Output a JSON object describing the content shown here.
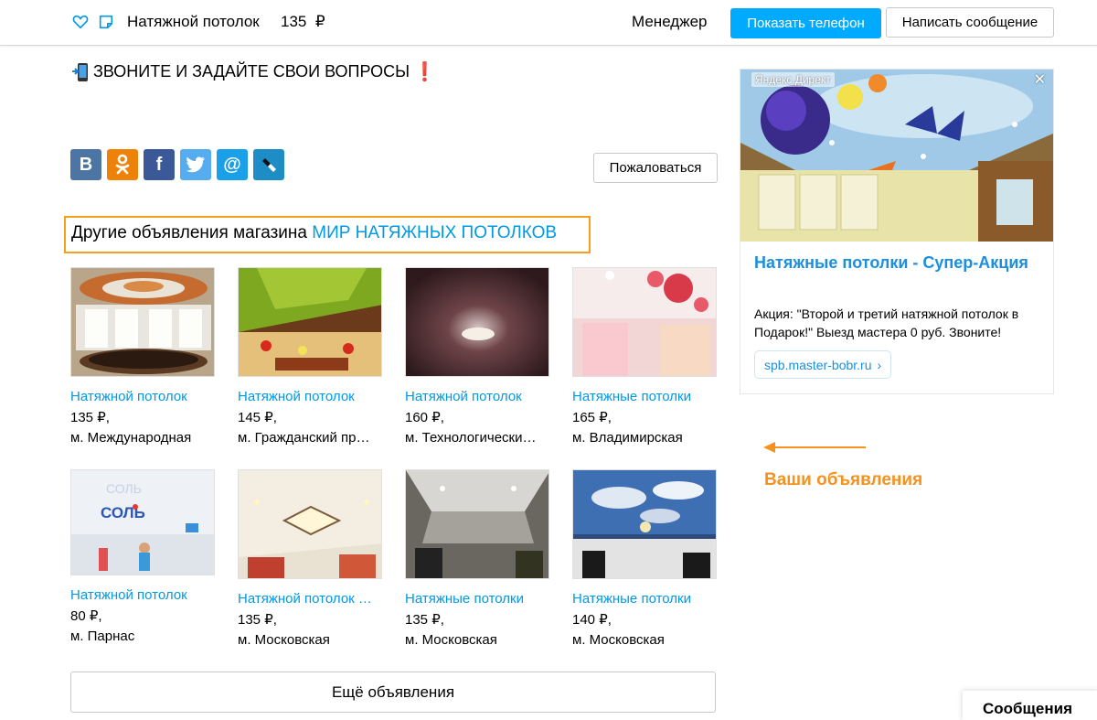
{
  "header": {
    "title": "Натяжной потолок",
    "price": "135",
    "currency": "₽",
    "manager": "Менеджер",
    "show_phone": "Показать телефон",
    "write_message": "Написать сообщение"
  },
  "description": {
    "call_text": "ЗВОНИТЕ И ЗАДАЙТЕ СВОИ ВОПРОСЫ",
    "exclamation": "❗"
  },
  "social": {
    "icons": [
      "vk-icon",
      "odnoklassniki-icon",
      "facebook-icon",
      "twitter-icon",
      "mailru-icon",
      "livejournal-icon"
    ],
    "vk_glyph": "В",
    "ok_glyph": "ок",
    "fb_glyph": "f",
    "mm_glyph": "@"
  },
  "complain": "Пожаловаться",
  "shop": {
    "prefix": "Другие объявления магазина",
    "name": "МИР НАТЯЖНЫХ ПОТОЛКОВ"
  },
  "listings": [
    {
      "title": "Натяжной потолок",
      "price": "135 ₽,",
      "metro": "м. Международная"
    },
    {
      "title": "Натяжной потолок",
      "price": "145 ₽,",
      "metro": "м. Гражданский пр…"
    },
    {
      "title": "Натяжной потолок",
      "price": "160 ₽,",
      "metro": "м. Технологически…"
    },
    {
      "title": "Натяжные потолки",
      "price": "165 ₽,",
      "metro": "м. Владимирская"
    },
    {
      "title": "Натяжной потолок",
      "price": "80 ₽,",
      "metro": "м. Парнас"
    },
    {
      "title": "Натяжной потолок …",
      "price": "135 ₽,",
      "metro": "м. Московская"
    },
    {
      "title": "Натяжные потолки",
      "price": "135 ₽,",
      "metro": "м. Московская"
    },
    {
      "title": "Натяжные потолки",
      "price": "140 ₽,",
      "metro": "м. Московская"
    }
  ],
  "more_button": "Ещё объявления",
  "ad": {
    "label": "Яндекс.Директ",
    "close": "✕",
    "title": "Натяжные потолки - Супер-Акция",
    "text": "Акция: \"Второй и третий натяжной потолок в Подарок!\" Выезд мастера 0 руб. Звоните!",
    "domain": "spb.master-bobr.ru",
    "domain_arrow": "›"
  },
  "annotation": {
    "text": "Ваши объявления",
    "color": "#f5921e"
  },
  "messages_tab": "Сообщения",
  "colors": {
    "accent_blue": "#00aaff",
    "link_blue": "#0099e6",
    "highlight_orange": "#f5a01a"
  }
}
